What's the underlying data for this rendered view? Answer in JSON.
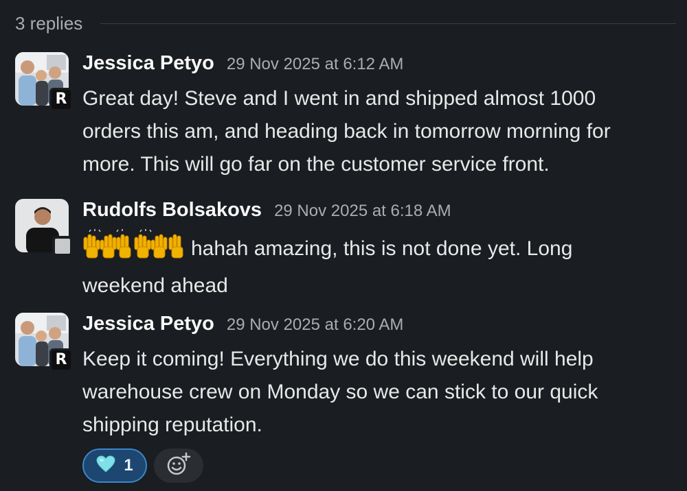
{
  "thread": {
    "replies_label": "3 replies"
  },
  "messages": [
    {
      "author": "Jessica Petyo",
      "timestamp": "29 Nov 2025 at 6:12 AM",
      "badge": "R",
      "lines": [
        "Great day! Steve and I went in and shipped almost 1000",
        "orders this am, and heading back in tomorrow morning for",
        "more. This will go far on the customer service front."
      ]
    },
    {
      "author": "Rudolfs Bolsakovs",
      "timestamp": "29 Nov 2025 at 6:18 AM",
      "emoji_icon": "raising-hands-emoji",
      "lines": [
        "hahah amazing, this is not done yet. Long",
        "weekend ahead"
      ]
    },
    {
      "author": "Jessica Petyo",
      "timestamp": "29 Nov 2025 at 6:20 AM",
      "badge": "R",
      "lines": [
        "Keep it coming! Everything we do this weekend will help",
        "warehouse crew on Monday so we can stick to our quick",
        "shipping reputation."
      ]
    }
  ],
  "reactions": [
    {
      "icon": "light-blue-heart-icon",
      "count": "1",
      "color": "#7fe0e8"
    }
  ],
  "add_reaction_icon": "add-reaction-icon",
  "colors": {
    "background": "#1a1d21",
    "reaction_bg": "#1d4670",
    "reaction_border": "#3a87c9"
  }
}
